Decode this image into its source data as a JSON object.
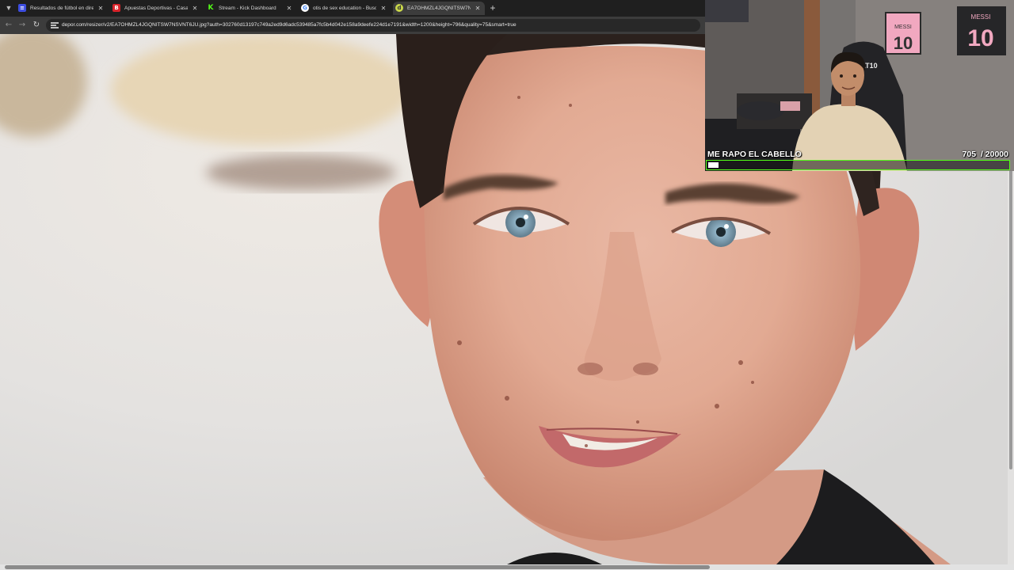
{
  "browser": {
    "tab_menu_icon": "chevron-down",
    "tabs": [
      {
        "title": "Resultados de fútbol en directo",
        "icon": "flashscore-icon",
        "icon_color": "#3d4de0",
        "active": false
      },
      {
        "title": "Apuestas Deportivas - Casa de",
        "icon": "betting-site-icon",
        "icon_color": "#d8232a",
        "active": false
      },
      {
        "title": "Stream - Kick Dashboard",
        "icon": "kick-icon",
        "icon_color": "#53fc18",
        "active": false
      },
      {
        "title": "otis de sex education - Buscar",
        "icon": "google-icon",
        "icon_color": "#ffffff",
        "active": false
      },
      {
        "title": "EA7OHMZL4JGQNITSW7NSVNT",
        "icon": "depor-icon",
        "icon_color": "#c8d64a",
        "active": true
      }
    ],
    "new_tab_label": "+",
    "close_glyph": "✕",
    "url": "depor.com/resizer/v2/EA7OHMZL4JGQNITSW7NSVNT6JU.jpg?auth=302760d13197c749a2ed9d6adc539485a7fc5b4d042e158a9deefe224d1e7191&width=1200&height=796&quality=75&smart=true"
  },
  "stream_overlay": {
    "goal_title": "ME RAPO EL CABELLO",
    "goal_current": "705",
    "goal_target": "/ 20000",
    "goal_progress": 0.035,
    "accent_color": "#53fc18",
    "wall_posters": [
      "MESSI",
      "10"
    ],
    "chair_text": "EAT10"
  }
}
